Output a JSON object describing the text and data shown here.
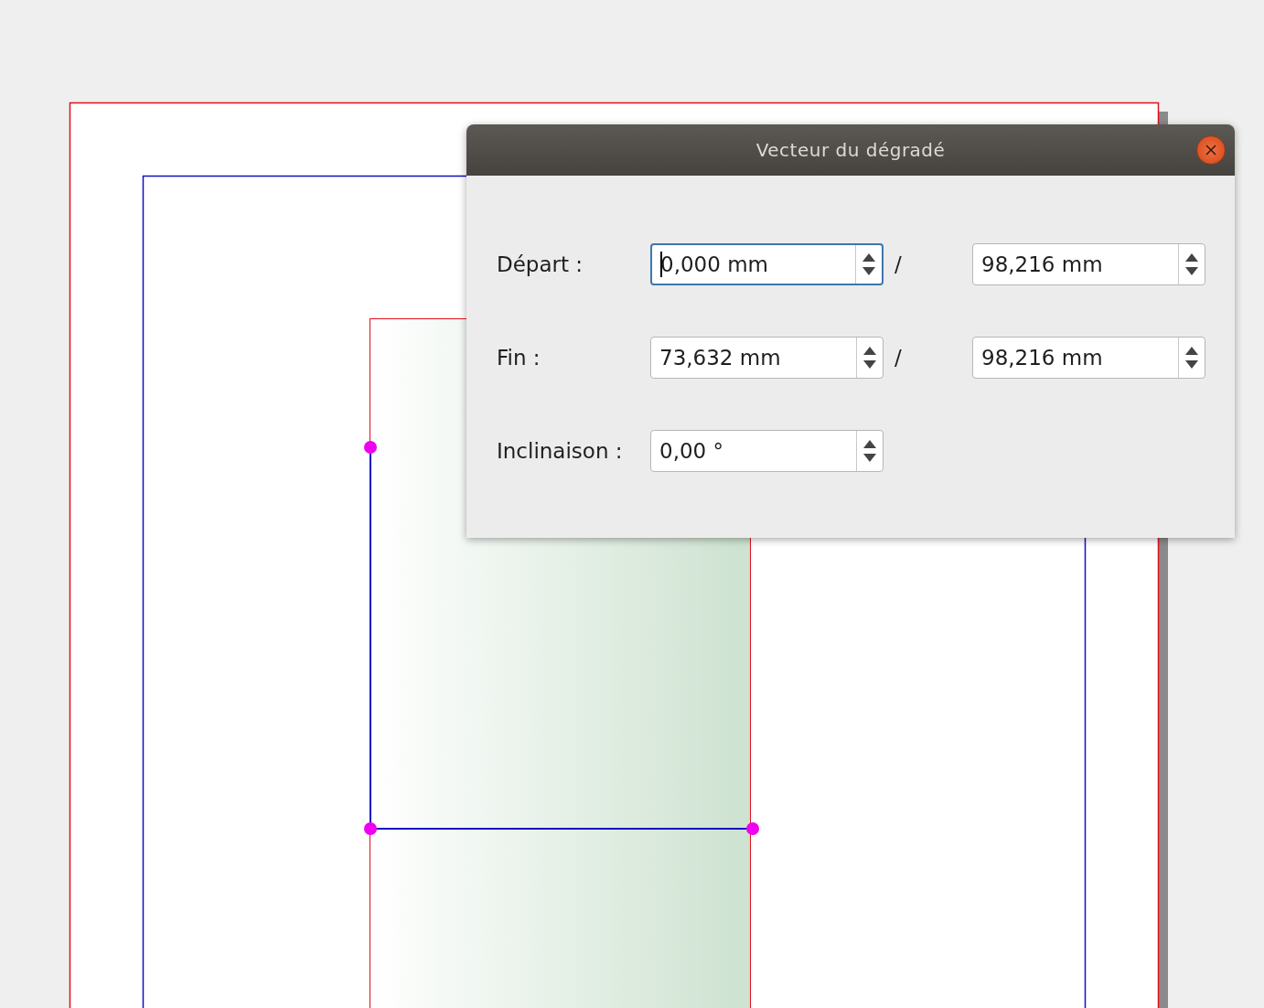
{
  "dialog": {
    "title": "Vecteur du dégradé"
  },
  "rows": [
    {
      "label": "Départ :",
      "fields": [
        {
          "value": "0,000 mm",
          "focused": true
        },
        {
          "value": "98,216 mm",
          "focused": false
        }
      ],
      "separator": "/"
    },
    {
      "label": "Fin :",
      "fields": [
        {
          "value": "73,632 mm",
          "focused": false
        },
        {
          "value": "98,216 mm",
          "focused": false
        }
      ],
      "separator": "/"
    },
    {
      "label": "Inclinaison :",
      "fields": [
        {
          "value": "0,00 °",
          "focused": false
        }
      ]
    }
  ]
}
